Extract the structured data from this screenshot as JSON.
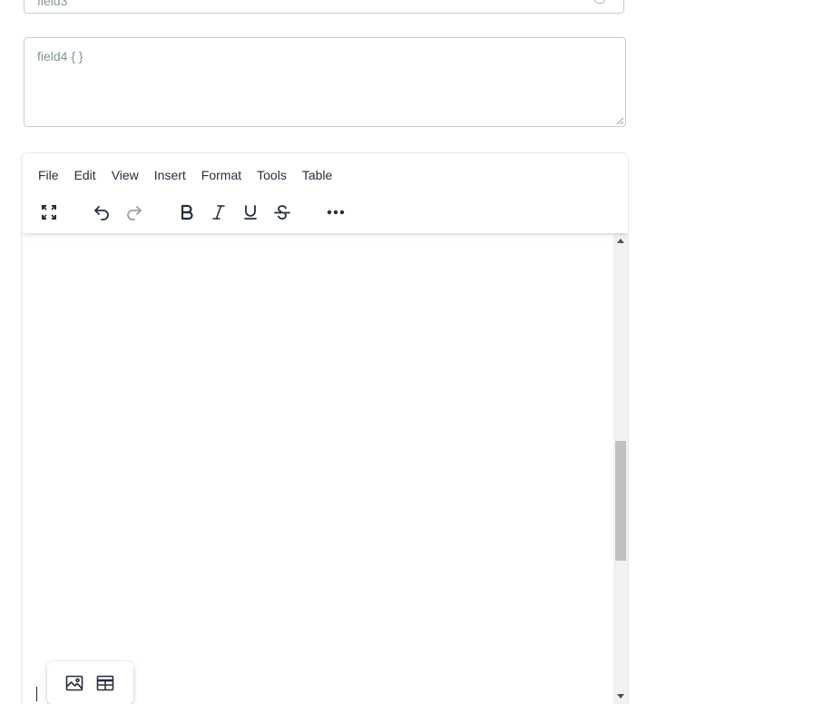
{
  "fields": {
    "field3_placeholder": "field3",
    "field4_placeholder": "field4 { }"
  },
  "editor": {
    "menubar": [
      "File",
      "Edit",
      "View",
      "Insert",
      "Format",
      "Tools",
      "Table"
    ],
    "toolbar": [
      {
        "name": "fullscreen-icon",
        "enabled": true
      },
      {
        "name": "undo-icon",
        "enabled": true
      },
      {
        "name": "redo-icon",
        "enabled": false
      },
      {
        "name": "bold-icon",
        "enabled": true
      },
      {
        "name": "italic-icon",
        "enabled": true
      },
      {
        "name": "underline-icon",
        "enabled": true
      },
      {
        "name": "strikethrough-icon",
        "enabled": true
      },
      {
        "name": "more-icon",
        "enabled": true
      }
    ],
    "quick_insert": [
      {
        "name": "image-icon"
      },
      {
        "name": "table-icon"
      }
    ]
  },
  "colors": {
    "icon": "#222f3e",
    "icon_disabled": "#9aa0a6",
    "placeholder": "#7f9496",
    "scroll_thumb": "#c1c1c1"
  }
}
